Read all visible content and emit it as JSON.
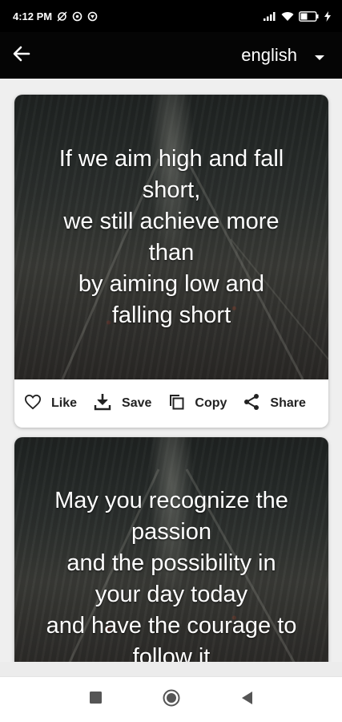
{
  "status_bar": {
    "time": "4:12 PM",
    "battery": "40"
  },
  "app_bar": {
    "language": "english"
  },
  "cards": [
    {
      "quote": "If we aim high and fall\nshort,\nwe still achieve more\nthan\nby aiming low and\nfalling short",
      "actions": {
        "like": "Like",
        "save": "Save",
        "copy": "Copy",
        "share": "Share"
      }
    },
    {
      "quote": "May you recognize the\npassion\nand the possibility in\nyour day today\nand have the courage to\nfollow it"
    }
  ],
  "icons": {
    "back": "arrow-left-icon",
    "dropdown": "caret-down-icon",
    "like": "heart-outline-icon",
    "save": "download-icon",
    "copy": "copy-icon",
    "share": "share-icon"
  }
}
